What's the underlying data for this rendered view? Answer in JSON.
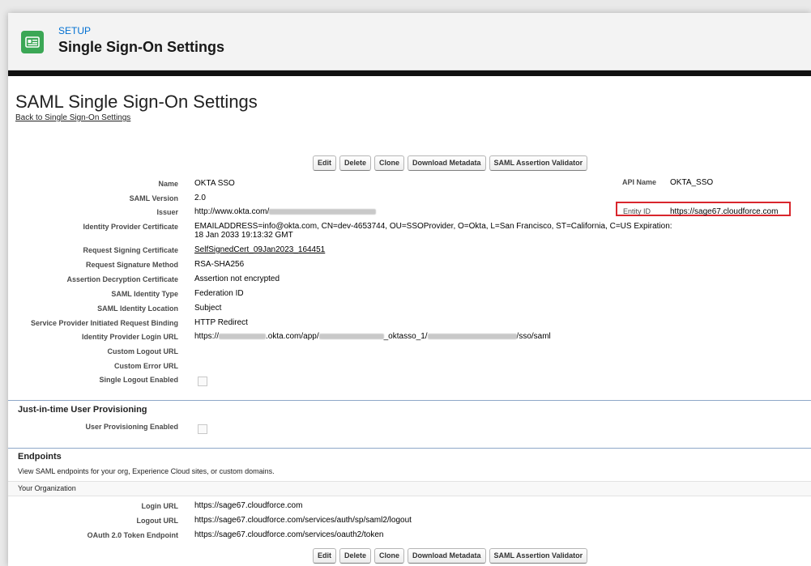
{
  "header": {
    "setup_label": "SETUP",
    "title": "Single Sign-On Settings",
    "icon_color": "#3ba755"
  },
  "page": {
    "title": "SAML Single Sign-On Settings",
    "back_link": "Back to Single Sign-On Settings"
  },
  "buttons": {
    "edit": "Edit",
    "delete": "Delete",
    "clone": "Clone",
    "download_metadata": "Download Metadata",
    "saml_validator": "SAML Assertion Validator"
  },
  "details": {
    "name": {
      "label": "Name",
      "value": "OKTA SSO"
    },
    "api_name": {
      "label": "API Name",
      "value": "OKTA_SSO"
    },
    "saml_version": {
      "label": "SAML Version",
      "value": "2.0"
    },
    "issuer": {
      "label": "Issuer",
      "value": "http://www.okta.com/"
    },
    "entity_id": {
      "label": "Entity ID",
      "value": "https://sage67.cloudforce.com"
    },
    "idp_cert": {
      "label": "Identity Provider Certificate",
      "value": "EMAILADDRESS=info@okta.com, CN=dev-4653744, OU=SSOProvider, O=Okta, L=San Francisco, ST=California, C=US Expiration: 18 Jan 2033 19:13:32 GMT"
    },
    "req_sign_cert": {
      "label": "Request Signing Certificate",
      "value": "SelfSignedCert_09Jan2023_164451"
    },
    "req_sign_method": {
      "label": "Request Signature Method",
      "value": "RSA-SHA256"
    },
    "assert_decrypt_cert": {
      "label": "Assertion Decryption Certificate",
      "value": "Assertion not encrypted"
    },
    "saml_identity_type": {
      "label": "SAML Identity Type",
      "value": "Federation ID"
    },
    "saml_identity_location": {
      "label": "SAML Identity Location",
      "value": "Subject"
    },
    "sp_binding": {
      "label": "Service Provider Initiated Request Binding",
      "value": "HTTP Redirect"
    },
    "idp_login_url": {
      "label": "Identity Provider Login URL",
      "value_prefix": "https://",
      "value_mid1": ".okta.com/app/",
      "value_mid2": "_oktasso_1/",
      "value_suffix": "/sso/saml"
    },
    "custom_logout_url": {
      "label": "Custom Logout URL",
      "value": ""
    },
    "custom_error_url": {
      "label": "Custom Error URL",
      "value": ""
    },
    "single_logout": {
      "label": "Single Logout Enabled",
      "checked": false
    }
  },
  "jit": {
    "heading": "Just-in-time User Provisioning",
    "user_provisioning": {
      "label": "User Provisioning Enabled",
      "checked": false
    }
  },
  "endpoints": {
    "heading": "Endpoints",
    "description": "View SAML endpoints for your org, Experience Cloud sites, or custom domains.",
    "org_label": "Your Organization",
    "login_url": {
      "label": "Login URL",
      "value": "https://sage67.cloudforce.com"
    },
    "logout_url": {
      "label": "Logout URL",
      "value": "https://sage67.cloudforce.com/services/auth/sp/saml2/logout"
    },
    "oauth_endpoint": {
      "label": "OAuth 2.0 Token Endpoint",
      "value": "https://sage67.cloudforce.com/services/oauth2/token"
    }
  }
}
